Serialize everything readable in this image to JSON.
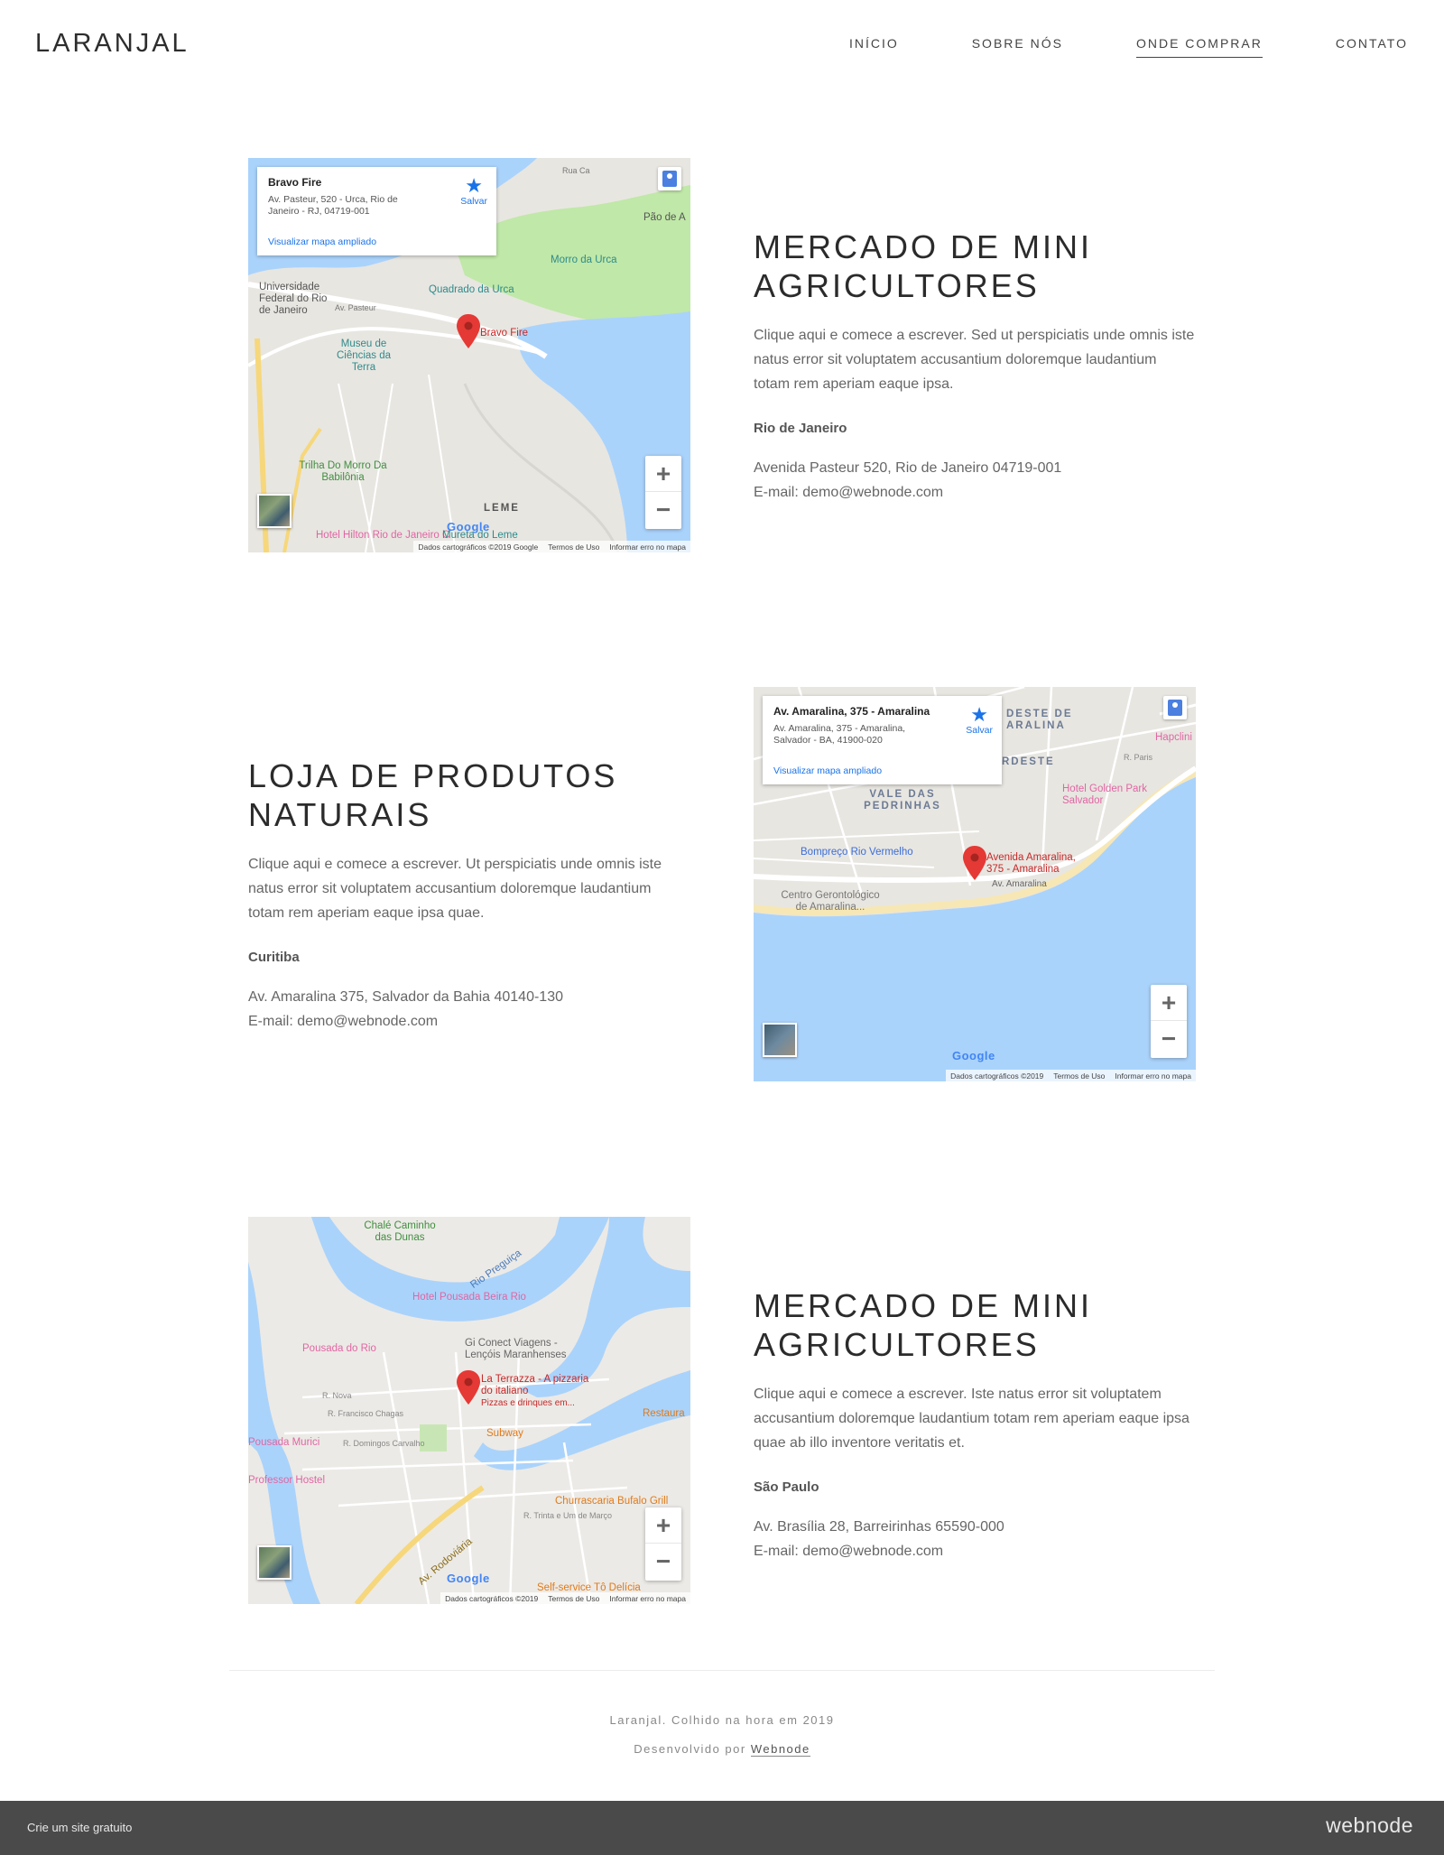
{
  "header": {
    "logo": "LARANJAL",
    "nav": [
      {
        "label": "INÍCIO"
      },
      {
        "label": "SOBRE NÓS"
      },
      {
        "label": "ONDE COMPRAR",
        "active": true
      },
      {
        "label": "CONTATO"
      }
    ]
  },
  "sections": [
    {
      "heading": "MERCADO DE MINI AGRICULTORES",
      "body": "Clique aqui e comece a escrever. Sed ut perspiciatis unde omnis iste natus error sit voluptatem accusantium doloremque laudantium totam rem aperiam eaque ipsa.",
      "city": "Rio de Janeiro",
      "address": "Avenida Pasteur 520, Rio de Janeiro 04719-001",
      "email": "E-mail: demo@webnode.com",
      "map": {
        "info_title": "Bravo Fire",
        "info_address": "Av. Pasteur, 520 - Urca, Rio de Janeiro - RJ, 04719-001",
        "info_link": "Visualizar mapa ampliado",
        "save_label": "Salvar",
        "pin_label": "Bravo Fire",
        "labels": [
          "Morro da Urca",
          "Quadrado da Urca",
          "Universidade Federal do Rio de Janeiro",
          "Museu de Ciências da Terra",
          "Trilha Do Morro Da Babilônia",
          "LEME",
          "Pão de A",
          "Hotel Hilton Rio de Janeiro C",
          "Mureta do Leme",
          "Av. Pasteur",
          "Rua Ca"
        ],
        "attribution": [
          "Dados cartográficos ©2019 Google",
          "Termos de Uso",
          "Informar erro no mapa"
        ],
        "google": "Google"
      }
    },
    {
      "heading": "LOJA DE PRODUTOS NATURAIS",
      "body": "Clique aqui e comece a escrever. Ut perspiciatis unde omnis iste natus error sit voluptatem accusantium doloremque laudantium totam rem aperiam eaque ipsa quae.",
      "city": "Curitiba",
      "address": "Av. Amaralina 375, Salvador da Bahia 40140-130",
      "email": "E-mail: demo@webnode.com",
      "map": {
        "info_title": "Av. Amaralina, 375 - Amaralina",
        "info_address": "Av. Amaralina, 375 - Amaralina, Salvador - BA, 41900-020",
        "info_link": "Visualizar mapa ampliado",
        "save_label": "Salvar",
        "pin_label": "Avenida Amaralina, 375 - Amaralina",
        "labels": [
          "DESTE DE ARALINA",
          "RDESTE",
          "VALE DAS PEDRINHAS",
          "Bompreço Rio Vermelho",
          "Centro Gerontológico de Amaralina...",
          "Hotel Golden Park Salvador",
          "Av. Amaralina",
          "Hapclini",
          "R. Paris"
        ],
        "attribution": [
          "Dados cartográficos ©2019",
          "Termos de Uso",
          "Informar erro no mapa"
        ],
        "google": "Google"
      }
    },
    {
      "heading": "MERCADO DE MINI AGRICULTORES",
      "body": "Clique aqui e comece a escrever. Iste natus error sit voluptatem accusantium doloremque laudantium totam rem aperiam eaque ipsa quae ab illo inventore veritatis et.",
      "city": "São Paulo",
      "address": "Av. Brasília 28, Barreirinhas 65590-000",
      "email": "E-mail: demo@webnode.com",
      "map": {
        "pin_label": "La Terrazza - A pizzaria do italiano",
        "pin_sub": "Pizzas e drinques em...",
        "labels": [
          "Chalé Caminho das Dunas",
          "Hotel Pousada Beira Rio",
          "Rio Preguiça",
          "Pousada do Rio",
          "Gi Conect Viagens - Lençóis Maranhenses",
          "Subway",
          "Restaura",
          "Pousada Murici",
          "Professor Hostel",
          "Churrascaria Bufalo Grill",
          "Av. Rodoviária",
          "Self-service Tô Delícia",
          "R. Trinta e Um de Março",
          "R. Nova",
          "R. Francisco Chagas",
          "R. Domingos Carvalho"
        ],
        "attribution": [
          "Dados cartográficos ©2019",
          "Termos de Uso",
          "Informar erro no mapa"
        ],
        "google": "Google"
      }
    }
  ],
  "footer": {
    "line1": "Laranjal. Colhido na hora em 2019",
    "line2_prefix": "Desenvolvido por",
    "line2_link": "Webnode"
  },
  "bottombar": {
    "left": "Crie um site gratuito",
    "right": "webnode"
  },
  "colors": {
    "water": "#aad3fb",
    "park": "#c0e8a8",
    "land": "#e8e6e1",
    "road": "#ffffff",
    "pin": "#e53935",
    "link": "#1a73e8",
    "bar": "#4a4a4a"
  }
}
